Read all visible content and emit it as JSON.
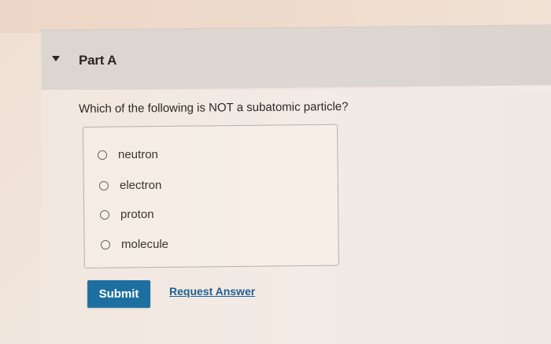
{
  "part": {
    "title": "Part A",
    "icon": "caret-down-icon"
  },
  "question": {
    "text": "Which of the following is NOT a subatomic particle?"
  },
  "options": [
    {
      "label": "neutron",
      "selected": false
    },
    {
      "label": "electron",
      "selected": false
    },
    {
      "label": "proton",
      "selected": false
    },
    {
      "label": "molecule",
      "selected": false
    }
  ],
  "actions": {
    "submit_label": "Submit",
    "request_answer_label": "Request Answer"
  },
  "colors": {
    "submit_bg": "#1d6fa0",
    "link": "#1f5f94",
    "header_bg": "#dcd6d1"
  }
}
